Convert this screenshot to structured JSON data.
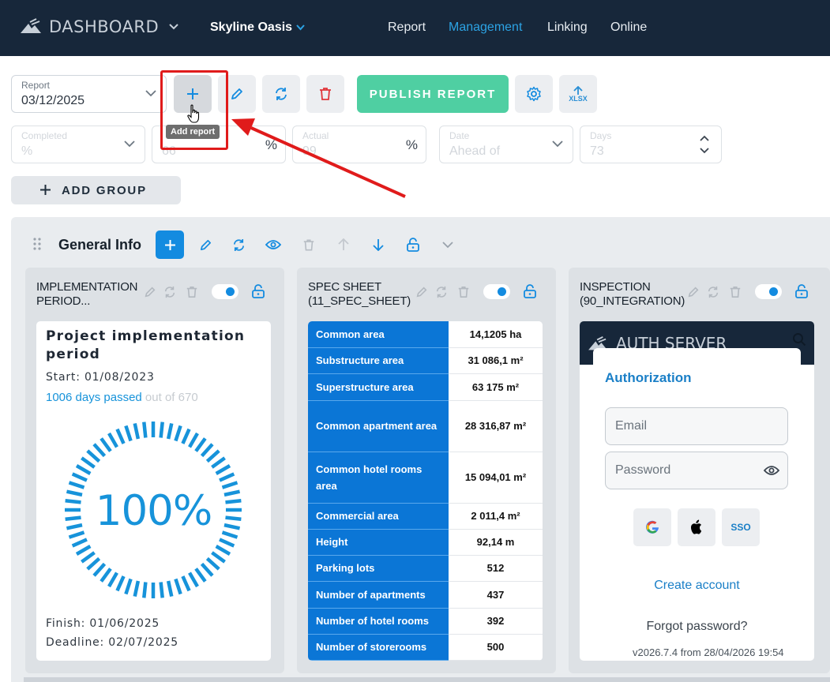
{
  "topbar": {
    "title": "DASHBOARD",
    "project": "Skyline Oasis",
    "nav": [
      "Report",
      "Management",
      "Linking",
      "Online"
    ],
    "active_nav": "Management"
  },
  "toolbar": {
    "report_label": "Report",
    "report_value": "03/12/2025",
    "publish_label": "PUBLISH REPORT",
    "xlsx_label": "XLSX",
    "tooltip": "Add report"
  },
  "filters": {
    "completed_label": "Completed",
    "completed_placeholder": "%",
    "planned_placeholder": "66",
    "planned_unit": "%",
    "actual_label": "Actual",
    "actual_placeholder": "99",
    "actual_unit": "%",
    "date_label": "Date",
    "date_placeholder": "Ahead of",
    "days_label": "Days",
    "days_placeholder": "73"
  },
  "add_group_label": "ADD GROUP",
  "group": {
    "title": "General Info"
  },
  "cards": {
    "implementation": {
      "title_line1": "IMPLEMENTATION",
      "title_line2": "PERIOD...",
      "heading_line1": "Project implementation",
      "heading_line2": "period",
      "start": "Start: 01/08/2023",
      "days_passed": "1006 days passed",
      "days_total": " out of 670",
      "percent": "100%",
      "progress": 1.0,
      "finish": "Finish: 01/06/2025",
      "deadline": "Deadline: 02/07/2025"
    },
    "spec": {
      "title_line1": "SPEC SHEET",
      "title_line2": "(11_SPEC_SHEET)",
      "rows": [
        {
          "k": "Common area",
          "v": "14,1205 ha"
        },
        {
          "k": "Substructure area",
          "v": "31 086,1 m²"
        },
        {
          "k": "Superstructure area",
          "v": "63 175 m²"
        },
        {
          "k": "Common apartment area",
          "v": "28 316,87 m²"
        },
        {
          "k": "Common hotel rooms area",
          "v": "15 094,01 m²"
        },
        {
          "k": "Commercial area",
          "v": "2 011,4 m²"
        },
        {
          "k": "Height",
          "v": "92,14 m"
        },
        {
          "k": "Parking lots",
          "v": "512"
        },
        {
          "k": "Number of apartments",
          "v": "437"
        },
        {
          "k": "Number of hotel rooms",
          "v": "392"
        },
        {
          "k": "Number of storerooms",
          "v": "500"
        }
      ]
    },
    "inspection": {
      "title_line1": "INSPECTION",
      "title_line2": "(90_INTEGRATION)",
      "server_title": "AUTH SERVER",
      "auth_title": "Authorization",
      "email_placeholder": "Email",
      "password_placeholder": "Password",
      "sso_label": "SSO",
      "create_account": "Create account",
      "forgot_password": "Forgot password?",
      "version": "v2026.7.4 from 28/04/2026 19:54"
    }
  },
  "colors": {
    "nav_bg": "#17273a",
    "accent": "#138be0",
    "publish": "#4fcfa2",
    "highlight": "#e01b1b"
  }
}
